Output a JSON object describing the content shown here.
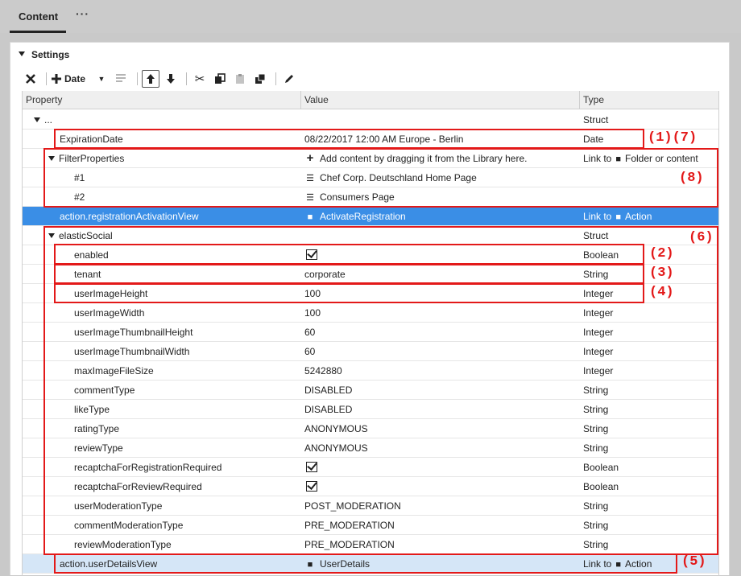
{
  "tabs": {
    "active": "Content",
    "more": "···"
  },
  "settings": {
    "title": "Settings"
  },
  "toolbar": {
    "date_label": "Date"
  },
  "columns": {
    "property": "Property",
    "value": "Value",
    "type": "Type"
  },
  "rows": [
    {
      "prop": "...",
      "value": "",
      "type": "Struct"
    },
    {
      "prop": "ExpirationDate",
      "value": "08/22/2017 12:00 AM Europe - Berlin",
      "type": "Date"
    },
    {
      "prop": "FilterProperties",
      "value": "Add content by dragging it from the Library here.",
      "type_prefix": "Link to",
      "type": "Folder or content"
    },
    {
      "prop": "#1",
      "value": "Chef Corp. Deutschland Home Page",
      "type": ""
    },
    {
      "prop": "#2",
      "value": "Consumers Page",
      "type": ""
    },
    {
      "prop": "action.registrationActivationView",
      "value": "ActivateRegistration",
      "type_prefix": "Link to",
      "type": "Action"
    },
    {
      "prop": "elasticSocial",
      "value": "",
      "type": "Struct"
    },
    {
      "prop": "enabled",
      "value": "",
      "type": "Boolean"
    },
    {
      "prop": "tenant",
      "value": "corporate",
      "type": "String"
    },
    {
      "prop": "userImageHeight",
      "value": "100",
      "type": "Integer"
    },
    {
      "prop": "userImageWidth",
      "value": "100",
      "type": "Integer"
    },
    {
      "prop": "userImageThumbnailHeight",
      "value": "60",
      "type": "Integer"
    },
    {
      "prop": "userImageThumbnailWidth",
      "value": "60",
      "type": "Integer"
    },
    {
      "prop": "maxImageFileSize",
      "value": "5242880",
      "type": "Integer"
    },
    {
      "prop": "commentType",
      "value": "DISABLED",
      "type": "String"
    },
    {
      "prop": "likeType",
      "value": "DISABLED",
      "type": "String"
    },
    {
      "prop": "ratingType",
      "value": "ANONYMOUS",
      "type": "String"
    },
    {
      "prop": "reviewType",
      "value": "ANONYMOUS",
      "type": "String"
    },
    {
      "prop": "recaptchaForRegistrationRequired",
      "value": "",
      "type": "Boolean"
    },
    {
      "prop": "recaptchaForReviewRequired",
      "value": "",
      "type": "Boolean"
    },
    {
      "prop": "userModerationType",
      "value": "POST_MODERATION",
      "type": "String"
    },
    {
      "prop": "commentModerationType",
      "value": "PRE_MODERATION",
      "type": "String"
    },
    {
      "prop": "reviewModerationType",
      "value": "PRE_MODERATION",
      "type": "String"
    },
    {
      "prop": "action.userDetailsView",
      "value": "UserDetails",
      "type_prefix": "Link to",
      "type": "Action"
    }
  ],
  "annotations": {
    "a1": "(1)(7)",
    "a2": "(2)",
    "a3": "(3)",
    "a4": "(4)",
    "a5": "(5)",
    "a6": "(6)",
    "a8": "(8)"
  },
  "colors": {
    "annotation": "#e31919",
    "selected_row": "#3a8ee6",
    "highlight_row": "#d5e6f7"
  }
}
